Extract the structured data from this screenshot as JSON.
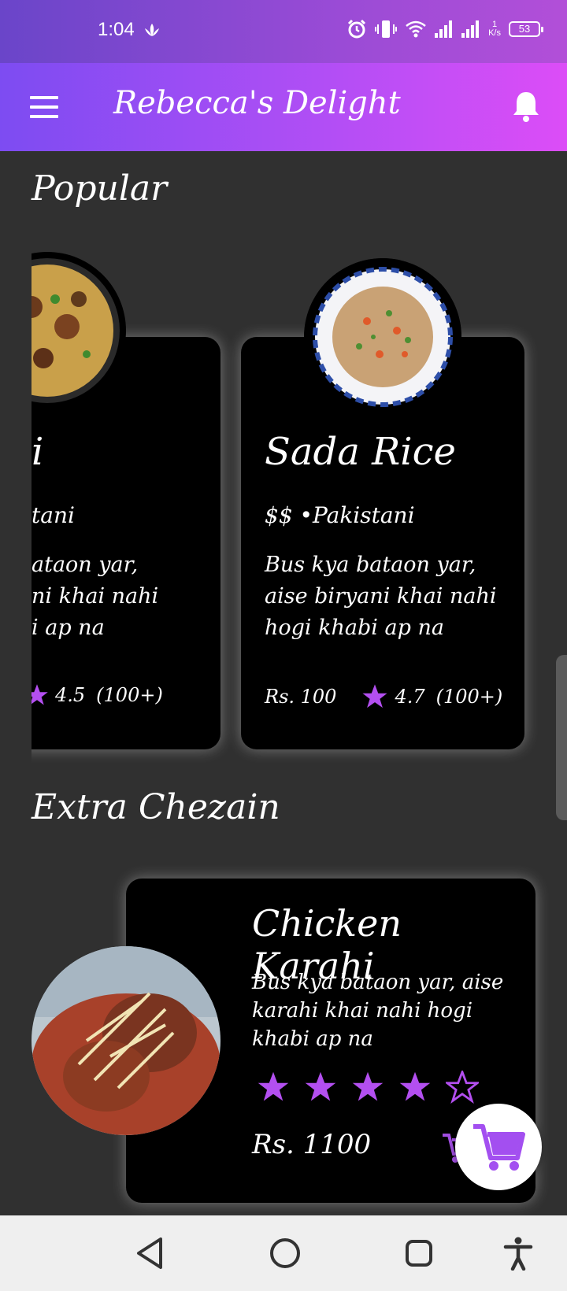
{
  "status_bar": {
    "time": "1:04",
    "speed_value": "1",
    "speed_unit": "K/s",
    "battery": "53"
  },
  "app_bar": {
    "title": "Rebecca's Delight"
  },
  "popular": {
    "title": "Popular",
    "cards": [
      {
        "name": "Mutton Biryani",
        "visible_name": "i",
        "cuisine": "tani",
        "desc_lines": [
          "ataon yar,",
          "ni khai nahi",
          "i ap na"
        ],
        "rating": "4.5",
        "count": "(100+)"
      },
      {
        "name": "Sada Rice",
        "cuisine": "$$ •Pakistani",
        "description": "Bus kya bataon yar, aise biryani khai nahi hogi khabi ap na",
        "price": "Rs. 100",
        "rating": "4.7",
        "count": "(100+)"
      }
    ]
  },
  "extra": {
    "title": "Extra Chezain",
    "item": {
      "name": "Chicken Karahi",
      "description": "Bus kya bataon yar, aise karahi khai nahi hogi khabi ap na",
      "stars_filled": 4,
      "stars_total": 5,
      "price": "Rs. 1100"
    }
  },
  "colors": {
    "accent": "#b44ef5",
    "star": "#b34ff0",
    "background": "#303030",
    "card": "#000000"
  },
  "icons": {
    "menu": "hamburger-icon",
    "notifications": "bell-icon",
    "cart": "cart-icon",
    "nav_back": "back-triangle-icon",
    "nav_home": "home-circle-icon",
    "nav_recents": "recents-square-icon",
    "nav_accessibility": "accessibility-icon"
  }
}
